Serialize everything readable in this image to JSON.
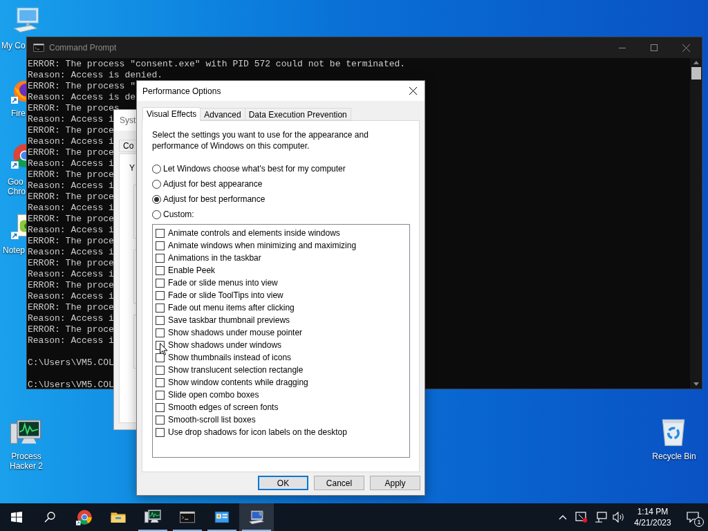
{
  "desktop_icons": [
    {
      "kind": "computer",
      "lines": [
        "My Co"
      ]
    },
    {
      "kind": "firefox",
      "lines": [
        "Fire"
      ]
    },
    {
      "kind": "chrome",
      "lines": [
        "Goo",
        "Chro"
      ]
    },
    {
      "kind": "notepad",
      "lines": [
        "Notep"
      ]
    },
    {
      "kind": "processhacker",
      "lines": [
        "Process",
        "Hacker 2"
      ]
    },
    {
      "kind": "recyclebin",
      "lines": [
        "Recycle Bin"
      ]
    }
  ],
  "command_prompt": {
    "title": "Command Prompt",
    "output": [
      "ERROR: The process \"consent.exe\" with PID 572 could not be terminated.",
      "Reason: Access is denied.",
      "ERROR: The process \"",
      "Reason: Access is de",
      "ERROR: The proces",
      "Reason: Access i",
      "ERROR: The proce",
      "Reason: Access i",
      "ERROR: The proce",
      "Reason: Access i",
      "ERROR: The proce",
      "Reason: Access i",
      "ERROR: The proce",
      "Reason: Access i",
      "ERROR: The proce",
      "Reason: Access i",
      "ERROR: The proce",
      "Reason: Access i",
      "ERROR: The proce",
      "Reason: Access i",
      "ERROR: The proce",
      "Reason: Access i",
      "ERROR: The proce",
      "Reason: Access i",
      "ERROR: The proce",
      "Reason: Access i"
    ],
    "prompts": [
      "C:\\Users\\VM5.COL",
      "C:\\Users\\VM5.COL"
    ]
  },
  "system_properties": {
    "title": "Syst",
    "tab": "Co",
    "intro": "Y"
  },
  "performance_options": {
    "title": "Performance Options",
    "tabs": [
      {
        "label": "Visual Effects",
        "selected": true
      },
      {
        "label": "Advanced",
        "selected": false
      },
      {
        "label": "Data Execution Prevention",
        "selected": false
      }
    ],
    "description": "Select the settings you want to use for the appearance and performance of Windows on this computer.",
    "radios": [
      {
        "label": "Let Windows choose what's best for my computer",
        "selected": false
      },
      {
        "label": "Adjust for best appearance",
        "selected": false
      },
      {
        "label": "Adjust for best performance",
        "selected": true
      },
      {
        "label": "Custom:",
        "selected": false
      }
    ],
    "effects": [
      {
        "label": "Animate controls and elements inside windows",
        "checked": false
      },
      {
        "label": "Animate windows when minimizing and maximizing",
        "checked": false
      },
      {
        "label": "Animations in the taskbar",
        "checked": false
      },
      {
        "label": "Enable Peek",
        "checked": false
      },
      {
        "label": "Fade or slide menus into view",
        "checked": false
      },
      {
        "label": "Fade or slide ToolTips into view",
        "checked": false
      },
      {
        "label": "Fade out menu items after clicking",
        "checked": false
      },
      {
        "label": "Save taskbar thumbnail previews",
        "checked": false
      },
      {
        "label": "Show shadows under mouse pointer",
        "checked": false
      },
      {
        "label": "Show shadows under windows",
        "checked": false
      },
      {
        "label": "Show thumbnails instead of icons",
        "checked": false
      },
      {
        "label": "Show translucent selection rectangle",
        "checked": false
      },
      {
        "label": "Show window contents while dragging",
        "checked": false
      },
      {
        "label": "Slide open combo boxes",
        "checked": false
      },
      {
        "label": "Smooth edges of screen fonts",
        "checked": false
      },
      {
        "label": "Smooth-scroll list boxes",
        "checked": false
      },
      {
        "label": "Use drop shadows for icon labels on the desktop",
        "checked": false
      }
    ],
    "buttons": [
      {
        "label": "OK",
        "default": true
      },
      {
        "label": "Cancel",
        "default": false
      },
      {
        "label": "Apply",
        "default": false
      }
    ]
  },
  "taskbar": {
    "apps": [
      {
        "kind": "chrome",
        "running": false,
        "selected": false
      },
      {
        "kind": "explorer",
        "running": false,
        "selected": false
      },
      {
        "kind": "processhacker",
        "running": true,
        "selected": false
      },
      {
        "kind": "cmd",
        "running": true,
        "selected": false
      },
      {
        "kind": "controlpanel",
        "running": true,
        "selected": false
      },
      {
        "kind": "sysprops",
        "running": true,
        "selected": true
      }
    ],
    "time": "1:14 PM",
    "date": "4/21/2023",
    "notification_count": "1"
  }
}
